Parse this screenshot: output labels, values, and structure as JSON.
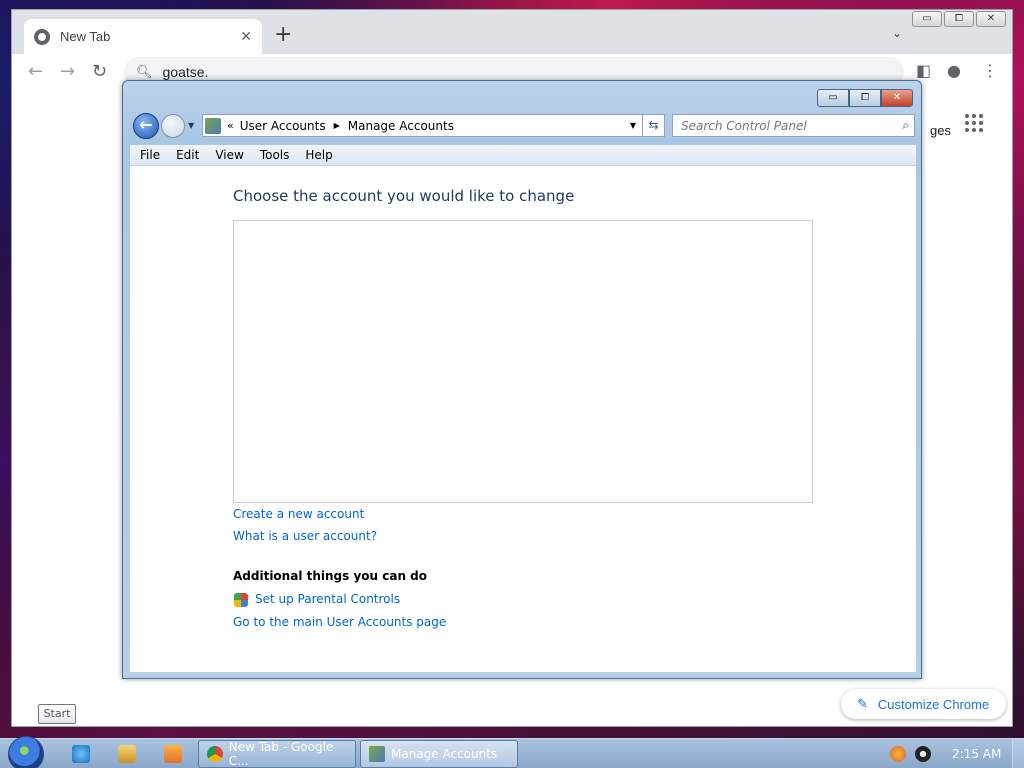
{
  "chrome": {
    "tab_title": "New Tab",
    "tab_close": "✕",
    "new_tab": "+",
    "tab_search": "⌄",
    "omnibox_value": "goatse.",
    "images_link": "ges",
    "customize_label": "Customize Chrome",
    "window_controls": {
      "min": "▭",
      "max": "⧠",
      "close": "✕"
    }
  },
  "explorer": {
    "breadcrumb": {
      "parent": "User Accounts",
      "current": "Manage Accounts",
      "chevron": "«",
      "separator": "▶"
    },
    "search_placeholder": "Search Control Panel",
    "menu": [
      "File",
      "Edit",
      "View",
      "Tools",
      "Help"
    ],
    "heading": "Choose the account you would like to change",
    "links": {
      "create": "Create a new account",
      "what_is": "What is a user account?",
      "parental": "Set up Parental Controls",
      "main_page": "Go to the main User Accounts page"
    },
    "subheading": "Additional things you can do",
    "window_controls": {
      "min": "▭",
      "max": "⧠",
      "close": "✕"
    }
  },
  "taskbar": {
    "buttons": [
      {
        "label": "New Tab - Google C..."
      },
      {
        "label": "Manage Accounts"
      }
    ],
    "clock": "2:15 AM",
    "start_tooltip": "Start"
  },
  "colors": {
    "link": "#0066cc",
    "heading": "#1e395b",
    "chrome_accent": "#1a73e8"
  }
}
